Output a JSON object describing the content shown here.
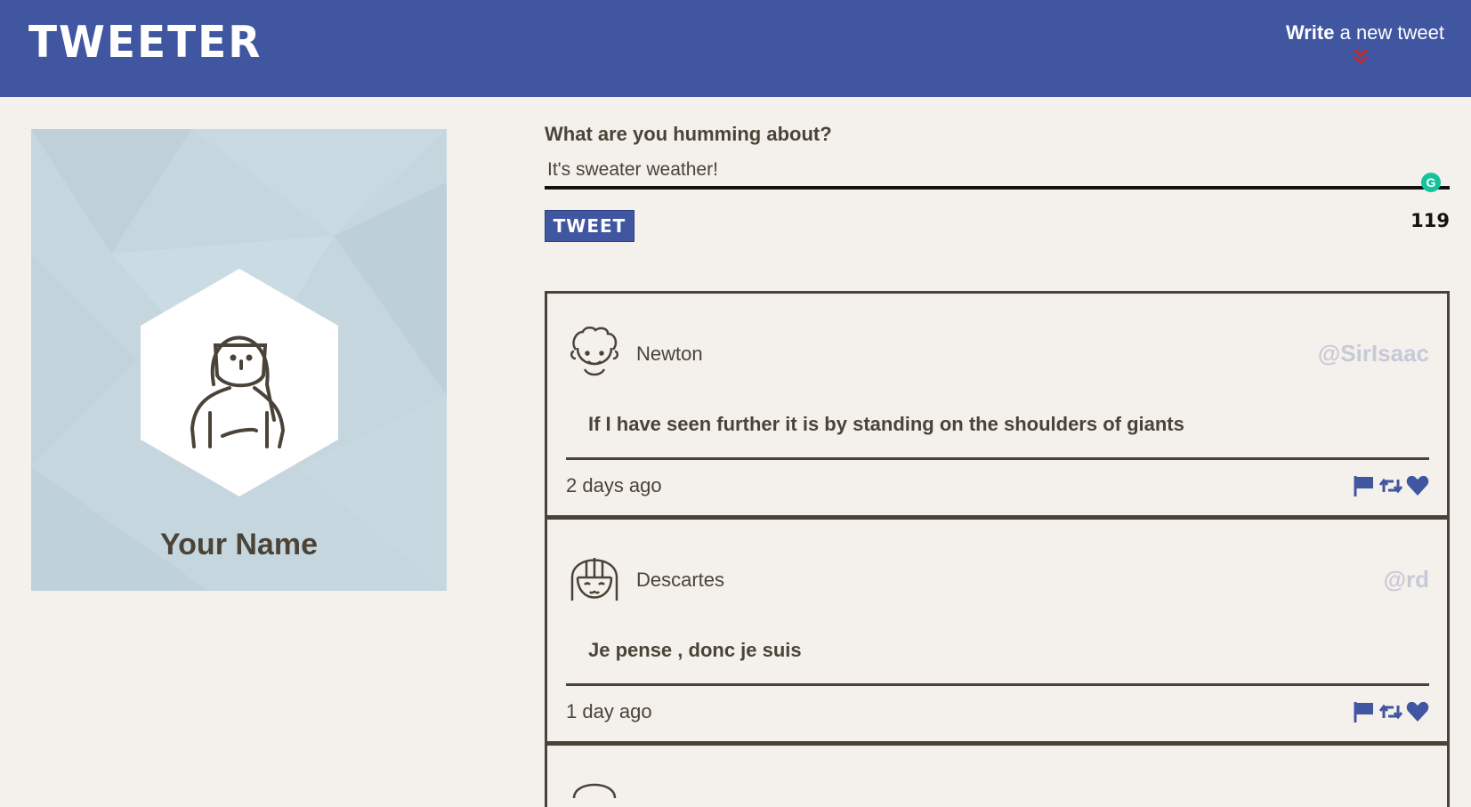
{
  "app": {
    "brand": "TWEETER",
    "compose_toggle": {
      "bold": "Write",
      "rest": " a new tweet",
      "icon": "double-chevron-down-icon",
      "icon_color": "#c0282d"
    }
  },
  "colors": {
    "brand": "#4056a1",
    "page_bg": "#f4f1ec",
    "card_bg": "#c5d6de",
    "text": "#4a4438",
    "handle": "#c8c9d8"
  },
  "profile": {
    "name": "Your Name",
    "avatar_icon": "girl-avatar-icon"
  },
  "compose": {
    "question": "What are you humming about?",
    "value": "It's sweater weather!",
    "button": "TWEET",
    "counter": "119",
    "grammarly": "G"
  },
  "tweets": [
    {
      "author": "Newton",
      "handle": "@SirIsaac",
      "avatar_icon": "curly-hair-avatar-icon",
      "body": "If I have seen further it is by standing on the shoulders of giants",
      "time": "2 days ago"
    },
    {
      "author": "Descartes",
      "handle": "@rd",
      "avatar_icon": "bob-hair-avatar-icon",
      "body": "Je pense , donc je suis",
      "time": "1 day ago"
    }
  ],
  "actions": [
    "flag-icon",
    "retweet-icon",
    "heart-icon"
  ]
}
